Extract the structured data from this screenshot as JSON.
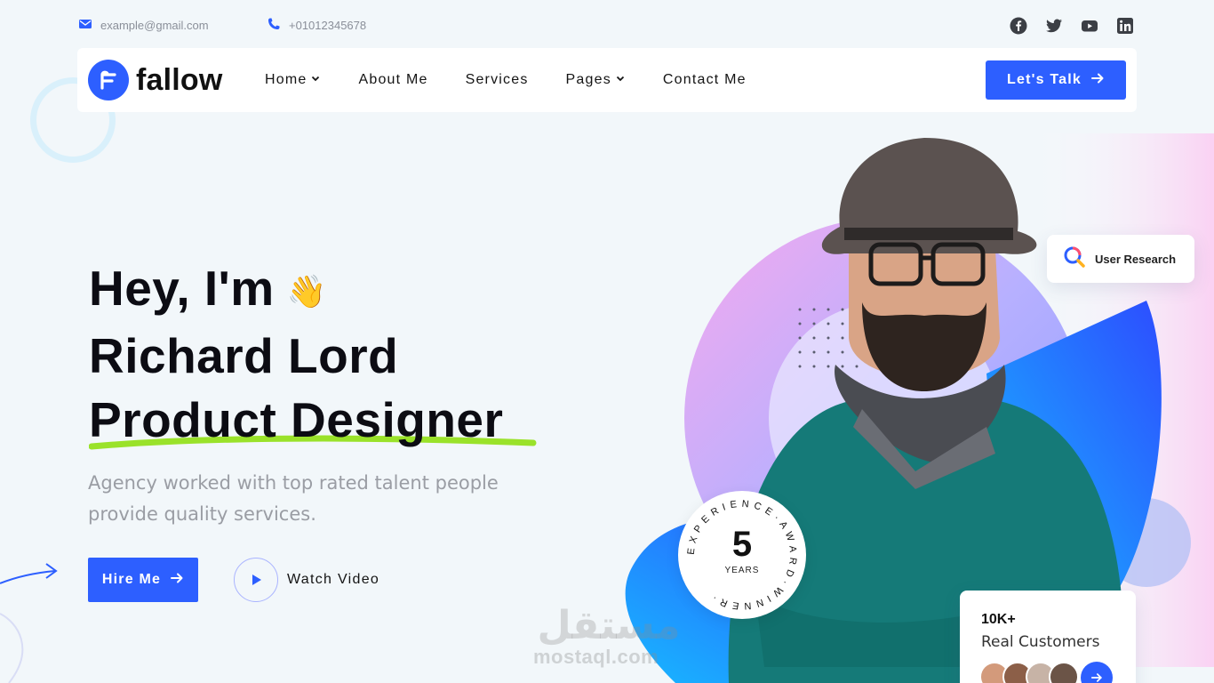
{
  "topbar": {
    "email": "example@gmail.com",
    "phone": "+01012345678",
    "socials": [
      "facebook-icon",
      "twitter-icon",
      "youtube-icon",
      "linkedin-icon"
    ]
  },
  "brand": {
    "name": "fallow",
    "accent": "#2d5fff"
  },
  "nav": {
    "items": [
      {
        "label": "Home",
        "dropdown": true
      },
      {
        "label": "About Me",
        "dropdown": false
      },
      {
        "label": "Services",
        "dropdown": false
      },
      {
        "label": "Pages",
        "dropdown": true
      },
      {
        "label": "Contact Me",
        "dropdown": false
      }
    ],
    "cta": "Let's Talk"
  },
  "hero": {
    "line1": "Hey, I'm",
    "wave": "👋",
    "line2": "Richard Lord",
    "line3": "Product Designer",
    "subtitle": "Agency worked with top rated talent people provide quality services.",
    "hire_label": "Hire Me",
    "watch_label": "Watch Video",
    "highlight_color": "#9ae22a"
  },
  "cards": {
    "research": "User Research",
    "badge": {
      "number": "5",
      "unit": "YEARS",
      "ring_text": "EXPERIENCE·AWARD·WINNER·"
    },
    "customers": {
      "count": "10K+",
      "label": "Real Customers"
    }
  },
  "watermark": {
    "text": "mostaql.com",
    "arabic": "مستقل"
  }
}
